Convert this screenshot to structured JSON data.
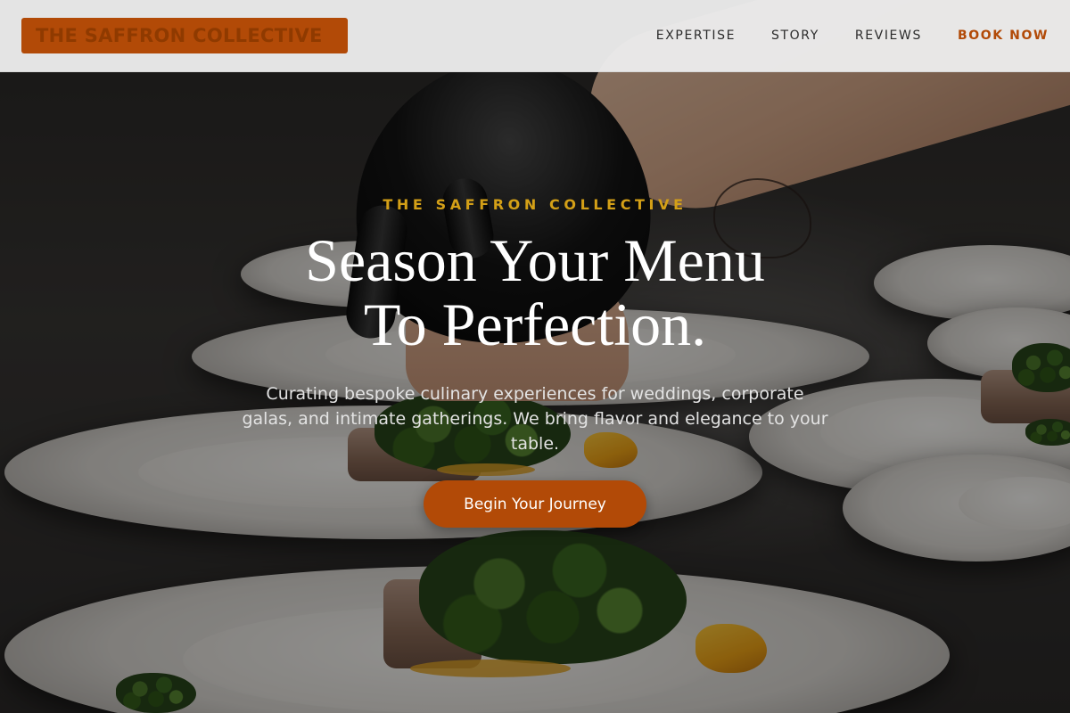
{
  "header": {
    "logo_text": "THE SAFFRON COLLECTIVE",
    "nav": [
      {
        "label": "EXPERTISE"
      },
      {
        "label": "STORY"
      },
      {
        "label": "REVIEWS"
      },
      {
        "label": "BOOK NOW"
      }
    ]
  },
  "hero": {
    "eyebrow": "THE SAFFRON COLLECTIVE",
    "headline_line1": "Season Your Menu",
    "headline_line2": "To Perfection.",
    "subtitle": "Curating bespoke culinary experiences for weddings, corporate galas, and intimate gatherings. We bring flavor and elegance to your table.",
    "cta_label": "Begin Your Journey"
  },
  "colors": {
    "accent": "#b24a07",
    "eyebrow": "#d4a017",
    "header_bg": "#ebebeb",
    "nav_text": "#2b2b2b"
  }
}
